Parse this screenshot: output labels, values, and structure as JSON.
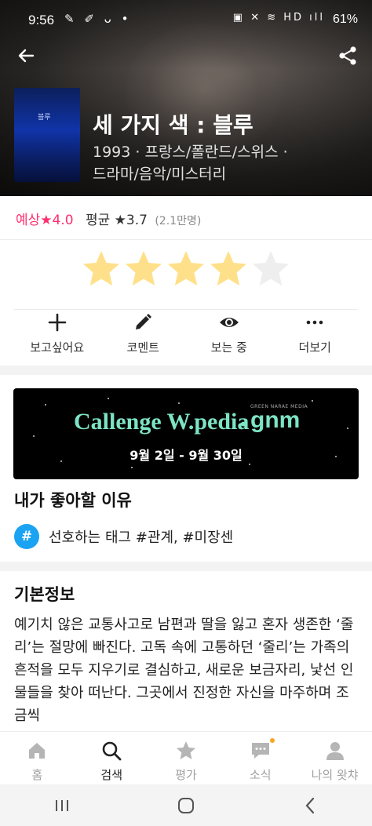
{
  "status_bar": {
    "time": "9:56",
    "left_icons_text": "✎ ✐ ᴗ •",
    "right_icons_text": "▣ ✕ ≋ HD ıll",
    "battery": "61%"
  },
  "header": {
    "back_icon": "arrow-left-icon",
    "share_icon": "share-icon",
    "poster_title": "블루",
    "title": "세 가지 색 : 블루",
    "meta_line1": "1993 · 프랑스/폴란드/스위스 ·",
    "meta_line2": "드라마/음악/미스터리"
  },
  "ratings": {
    "expected_label": "예상",
    "expected_value": "★4.0",
    "average_label": "평균",
    "average_value": "★3.7",
    "count": "(2.1만명)"
  },
  "my_rating": {
    "max": 5,
    "value": 4,
    "filled_color": "#ffe08a",
    "empty_color": "#eeeeee"
  },
  "actions": [
    {
      "label": "보고싶어요",
      "icon": "plus-icon"
    },
    {
      "label": "코멘트",
      "icon": "pencil-icon"
    },
    {
      "label": "보는 중",
      "icon": "eye-icon"
    },
    {
      "label": "더보기",
      "icon": "more-icon"
    }
  ],
  "banner": {
    "title": "Callenge W.pedia",
    "separator": "•",
    "partner_logo": "gnm",
    "partner_small": "GREEN NARAE MEDIA",
    "date": "9월 2일 - 9월 30일",
    "accent_color": "#7de4c3"
  },
  "reason": {
    "title": "내가 좋아할 이유",
    "badge": "#",
    "tag_text": "선호하는 태그 #관계, #미장센"
  },
  "info": {
    "title": "기본정보",
    "synopsis": "예기치 않은 교통사고로 남편과 딸을 잃고 혼자 생존한 ‘줄리’는 절망에 빠진다. 고독 속에 고통하던 ‘줄리’는 가족의 흔적을 모두 지우기로 결심하고, 새로운 보금자리, 낯선 인물들을 찾아 떠난다. 그곳에서 진정한 자신을 마주하며 조금씩"
  },
  "bottom_nav": [
    {
      "label": "홈",
      "icon": "home-icon",
      "active": false
    },
    {
      "label": "검색",
      "icon": "search-icon",
      "active": true
    },
    {
      "label": "평가",
      "icon": "star-icon",
      "active": false
    },
    {
      "label": "소식",
      "icon": "chat-icon",
      "active": false
    },
    {
      "label": "나의 왓챠",
      "icon": "person-icon",
      "active": false
    }
  ],
  "system_nav": {
    "recents_icon": "recents-icon",
    "home_icon": "home-circle-icon",
    "back_icon": "back-chevron-icon"
  }
}
